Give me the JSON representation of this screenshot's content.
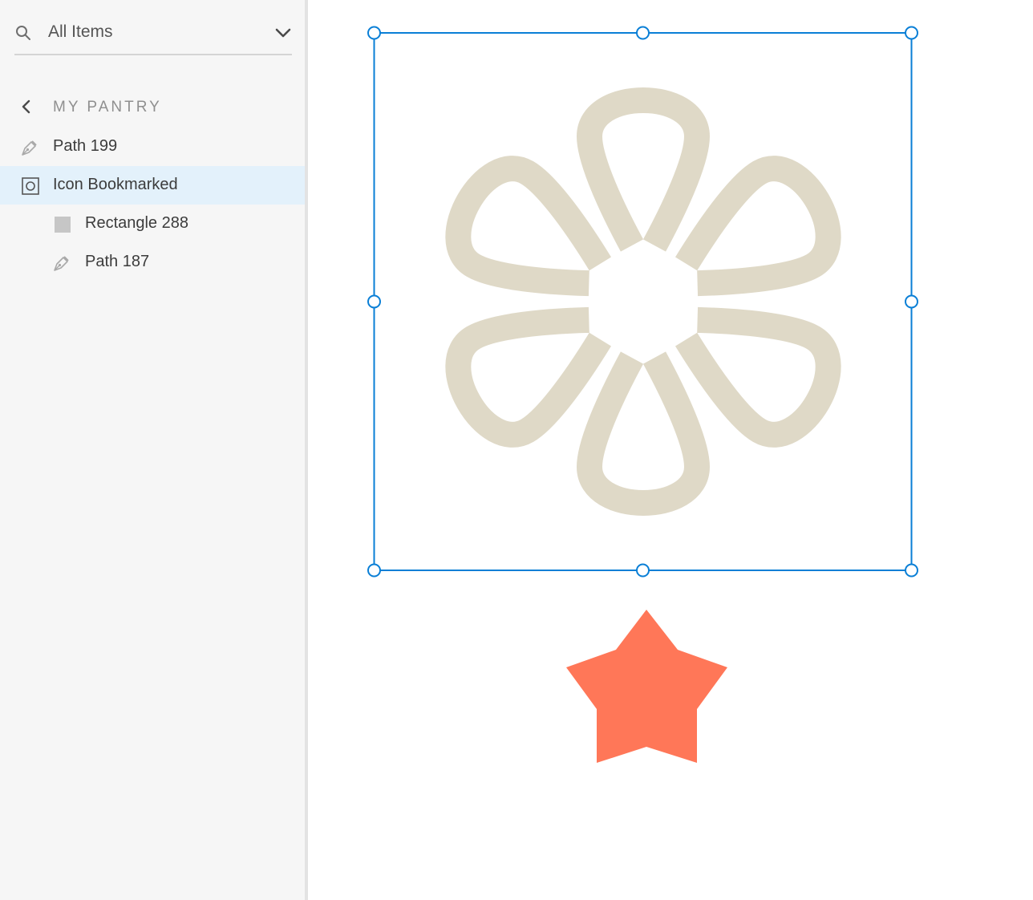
{
  "search": {
    "value": "All Items",
    "icon": "search-icon",
    "dropdown_icon": "chevron-down-icon"
  },
  "section": {
    "back_icon": "chevron-left-icon",
    "title": "MY PANTRY"
  },
  "layers": [
    {
      "label": "Path 199",
      "icon": "pen-path-icon",
      "level": 0,
      "selected": false
    },
    {
      "label": "Icon Bookmarked",
      "icon": "group-icon",
      "level": 0,
      "selected": true
    },
    {
      "label": "Rectangle 288",
      "icon": "rectangle-icon",
      "level": 1,
      "selected": false
    },
    {
      "label": "Path 187",
      "icon": "pen-path-icon",
      "level": 1,
      "selected": false
    }
  ],
  "colors": {
    "sidebar_bg": "#f6f6f6",
    "selected_row": "#e3f1fb",
    "selection_accent": "#0a7fd6",
    "flower_fill": "#dfd9c7",
    "star_fill": "#ff7758"
  },
  "canvas": {
    "selected_object": "Icon Bookmarked",
    "shapes": [
      "flower-icon",
      "star-icon"
    ]
  }
}
